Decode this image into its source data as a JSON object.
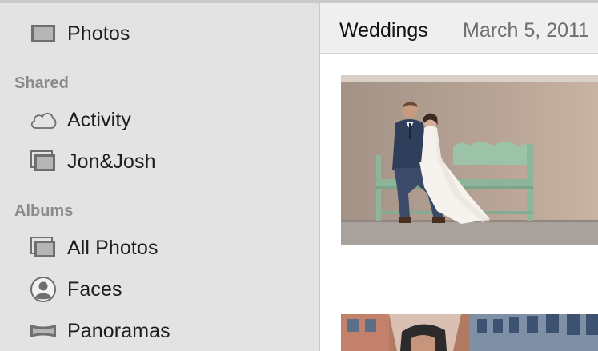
{
  "sidebar": {
    "top_item": {
      "label": "Photos",
      "icon": "photos-icon"
    },
    "shared": {
      "heading": "Shared",
      "items": [
        {
          "label": "Activity",
          "icon": "cloud-icon"
        },
        {
          "label": "Jon&Josh",
          "icon": "stacked-photos-icon"
        }
      ]
    },
    "albums": {
      "heading": "Albums",
      "items": [
        {
          "label": "All Photos",
          "icon": "stacked-photos-icon"
        },
        {
          "label": "Faces",
          "icon": "person-icon"
        },
        {
          "label": "Panoramas",
          "icon": "panorama-icon"
        }
      ]
    }
  },
  "header": {
    "album_title": "Weddings",
    "date": "March 5, 2011"
  },
  "colors": {
    "sidebar_bg": "#e3e3e3",
    "header_bg": "#efefef",
    "section_heading": "#8a8a8a",
    "icon_gray": "#6e6e6e"
  }
}
